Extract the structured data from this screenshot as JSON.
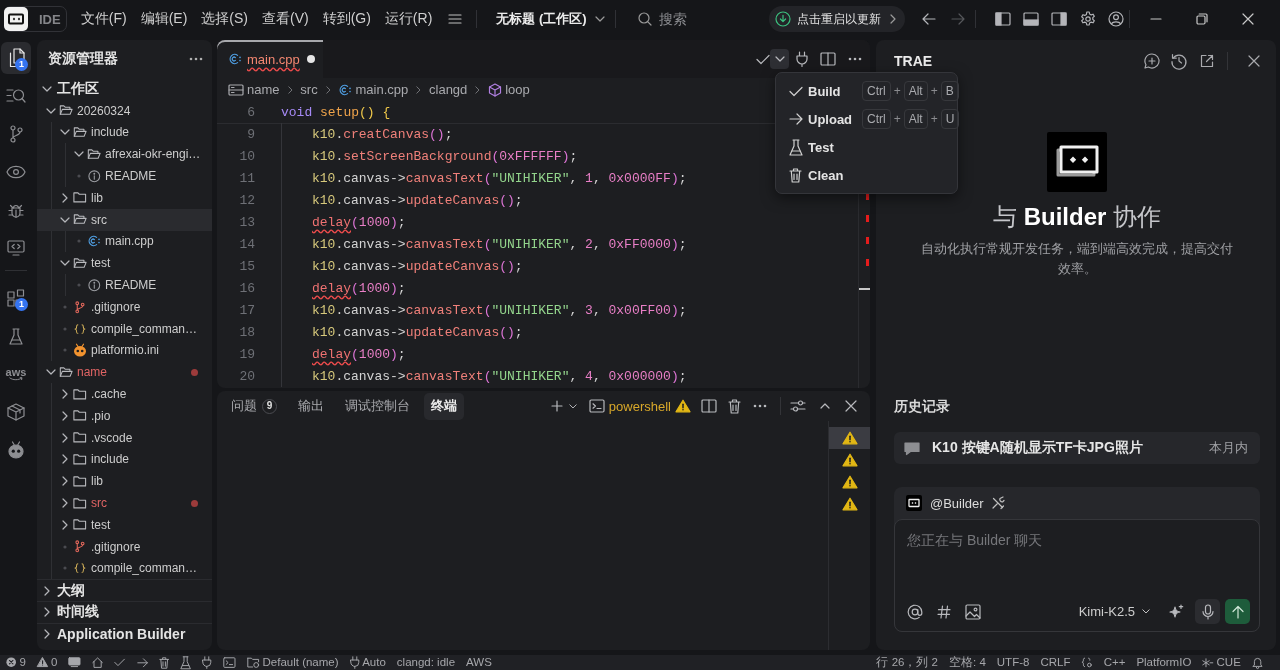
{
  "title_bar": {
    "app": "IDE",
    "menus": [
      "文件(F)",
      "编辑(E)",
      "选择(S)",
      "查看(V)",
      "转到(G)",
      "运行(R)"
    ],
    "workspace": "无标题 (工作区)",
    "search": {
      "placeholder": "搜索"
    },
    "update": "点击重启以更新",
    "navigation": [
      {
        "kind": "back",
        "disabled": false
      },
      {
        "kind": "forward",
        "disabled": true
      }
    ],
    "layout_toggles": [
      {
        "kind": "primary-sidebar",
        "on": true
      },
      {
        "kind": "panel",
        "on": true
      },
      {
        "kind": "secondary-sidebar",
        "on": true
      }
    ]
  },
  "activity_bar": {
    "groups": [
      {
        "items": [
          {
            "kind": "explorer",
            "selected": true,
            "badge": "1"
          },
          {
            "kind": "search",
            "selected": false
          },
          {
            "kind": "source-control",
            "selected": false
          },
          {
            "kind": "preview",
            "selected": false
          },
          {
            "kind": "debug",
            "selected": false
          },
          {
            "kind": "remote",
            "selected": false
          }
        ]
      },
      {
        "items": [
          {
            "kind": "extensions",
            "selected": false,
            "badge": "1"
          },
          {
            "kind": "testing",
            "selected": false
          },
          {
            "kind": "aws",
            "selected": false,
            "label": "aws"
          },
          {
            "kind": "packages",
            "selected": false
          },
          {
            "kind": "platformio",
            "selected": false
          }
        ]
      }
    ]
  },
  "explorer": {
    "title": "资源管理器",
    "tree": [
      {
        "kind": "root",
        "label": "工作区",
        "expanded": true,
        "selected": false,
        "error": false,
        "children": [
          {
            "kind": "folder",
            "label": "20260324",
            "expanded": true,
            "selected": false,
            "error": false,
            "children": [
              {
                "kind": "folder",
                "label": "include",
                "expanded": true,
                "selected": false,
                "error": false,
                "children": [
                  {
                    "kind": "folder",
                    "label": "afrexai-okr-engi…",
                    "expanded": true,
                    "selected": false,
                    "error": false
                  },
                  {
                    "kind": "readme",
                    "label": "README",
                    "selected": false,
                    "error": false
                  }
                ]
              },
              {
                "kind": "folder",
                "label": "lib",
                "expanded": false,
                "selected": false,
                "error": false
              },
              {
                "kind": "folder",
                "label": "src",
                "expanded": true,
                "selected": true,
                "error": false,
                "children": [
                  {
                    "kind": "cpp",
                    "label": "main.cpp",
                    "selected": false,
                    "error": false
                  }
                ]
              },
              {
                "kind": "folder",
                "label": "test",
                "expanded": true,
                "selected": false,
                "error": false,
                "children": [
                  {
                    "kind": "readme",
                    "label": "README",
                    "selected": false,
                    "error": false
                  }
                ]
              },
              {
                "kind": "git",
                "label": ".gitignore",
                "selected": false,
                "error": false
              },
              {
                "kind": "json",
                "label": "compile_comman…",
                "selected": false,
                "error": false
              },
              {
                "kind": "platformio",
                "label": "platformio.ini",
                "selected": false,
                "error": false
              }
            ]
          },
          {
            "kind": "folder",
            "label": "name",
            "expanded": true,
            "selected": false,
            "error": true,
            "children": [
              {
                "kind": "folder",
                "label": ".cache",
                "expanded": false,
                "selected": false,
                "error": false
              },
              {
                "kind": "folder",
                "label": ".pio",
                "expanded": false,
                "selected": false,
                "error": false
              },
              {
                "kind": "folder",
                "label": ".vscode",
                "expanded": false,
                "selected": false,
                "error": false
              },
              {
                "kind": "folder",
                "label": "include",
                "expanded": false,
                "selected": false,
                "error": false
              },
              {
                "kind": "folder",
                "label": "lib",
                "expanded": false,
                "selected": false,
                "error": false
              },
              {
                "kind": "folder",
                "label": "src",
                "expanded": false,
                "selected": false,
                "error": true
              },
              {
                "kind": "folder",
                "label": "test",
                "expanded": false,
                "selected": false,
                "error": false
              },
              {
                "kind": "git",
                "label": ".gitignore",
                "selected": false,
                "error": false
              },
              {
                "kind": "json",
                "label": "compile_comman…",
                "selected": false,
                "error": false
              }
            ]
          }
        ]
      }
    ],
    "sections": [
      {
        "label": "大纲",
        "expanded": false
      },
      {
        "label": "时间线",
        "expanded": false
      },
      {
        "label": "Application Builder",
        "expanded": false
      }
    ]
  },
  "editor": {
    "tabs": [
      {
        "kind": "cpp",
        "label": "main.cpp",
        "selected": true,
        "modified": true,
        "error": true
      }
    ],
    "run_menu": {
      "open": true,
      "items": [
        {
          "kind": "build",
          "label": "Build",
          "shortcut": [
            "Ctrl",
            "+",
            "Alt",
            "+",
            "B"
          ]
        },
        {
          "kind": "upload",
          "label": "Upload",
          "shortcut": [
            "Ctrl",
            "+",
            "Alt",
            "+",
            "U"
          ]
        },
        {
          "kind": "test",
          "label": "Test"
        },
        {
          "kind": "clean",
          "label": "Clean"
        }
      ]
    },
    "breadcrumb": [
      {
        "kind": "root",
        "label": "name"
      },
      {
        "kind": "folder",
        "label": "src"
      },
      {
        "kind": "cpp",
        "label": "main.cpp"
      },
      {
        "kind": "text",
        "label": "clangd"
      },
      {
        "kind": "symbol",
        "label": "loop"
      }
    ],
    "sticky_lines": [
      {
        "number": "6",
        "indented": false,
        "tokens": [
          {
            "kind": "kw",
            "text": "void"
          },
          {
            "kind": "fndef",
            "text": " setup"
          },
          {
            "kind": "bracket",
            "text": "() {"
          }
        ]
      }
    ],
    "lines": [
      {
        "number": "9",
        "indented": true,
        "tokens": [
          {
            "kind": "var",
            "text": "k10"
          },
          {
            "kind": "plain",
            "text": "."
          },
          {
            "kind": "fn",
            "text": "creatCanvas"
          },
          {
            "kind": "paren",
            "text": "()"
          },
          {
            "kind": "plain",
            "text": ";"
          }
        ]
      },
      {
        "number": "10",
        "indented": true,
        "tokens": [
          {
            "kind": "var",
            "text": "k10"
          },
          {
            "kind": "plain",
            "text": "."
          },
          {
            "kind": "fn",
            "text": "setScreenBackground"
          },
          {
            "kind": "paren",
            "text": "("
          },
          {
            "kind": "num",
            "text": "0xFFFFFF"
          },
          {
            "kind": "paren",
            "text": ")"
          },
          {
            "kind": "plain",
            "text": ";"
          }
        ]
      },
      {
        "number": "11",
        "indented": true,
        "tokens": [
          {
            "kind": "var",
            "text": "k10"
          },
          {
            "kind": "plain",
            "text": ".canvas->"
          },
          {
            "kind": "fn",
            "text": "canvasText"
          },
          {
            "kind": "paren",
            "text": "("
          },
          {
            "kind": "str",
            "text": "\"UNIHIKER\""
          },
          {
            "kind": "plain",
            "text": ", "
          },
          {
            "kind": "num",
            "text": "1"
          },
          {
            "kind": "plain",
            "text": ", "
          },
          {
            "kind": "num",
            "text": "0x0000FF"
          },
          {
            "kind": "paren",
            "text": ")"
          },
          {
            "kind": "plain",
            "text": ";"
          }
        ]
      },
      {
        "number": "12",
        "indented": true,
        "tokens": [
          {
            "kind": "var",
            "text": "k10"
          },
          {
            "kind": "plain",
            "text": ".canvas->"
          },
          {
            "kind": "fn",
            "text": "updateCanvas"
          },
          {
            "kind": "paren",
            "text": "()"
          },
          {
            "kind": "plain",
            "text": ";"
          }
        ]
      },
      {
        "number": "13",
        "indented": true,
        "tokens": [
          {
            "kind": "unresolved",
            "text": "delay"
          },
          {
            "kind": "paren",
            "text": "("
          },
          {
            "kind": "num",
            "text": "1000"
          },
          {
            "kind": "paren",
            "text": ")"
          },
          {
            "kind": "plain",
            "text": ";"
          }
        ]
      },
      {
        "number": "14",
        "indented": true,
        "tokens": [
          {
            "kind": "var",
            "text": "k10"
          },
          {
            "kind": "plain",
            "text": ".canvas->"
          },
          {
            "kind": "fn",
            "text": "canvasText"
          },
          {
            "kind": "paren",
            "text": "("
          },
          {
            "kind": "str",
            "text": "\"UNIHIKER\""
          },
          {
            "kind": "plain",
            "text": ", "
          },
          {
            "kind": "num",
            "text": "2"
          },
          {
            "kind": "plain",
            "text": ", "
          },
          {
            "kind": "num",
            "text": "0xFF0000"
          },
          {
            "kind": "paren",
            "text": ")"
          },
          {
            "kind": "plain",
            "text": ";"
          }
        ]
      },
      {
        "number": "15",
        "indented": true,
        "tokens": [
          {
            "kind": "var",
            "text": "k10"
          },
          {
            "kind": "plain",
            "text": ".canvas->"
          },
          {
            "kind": "fn",
            "text": "updateCanvas"
          },
          {
            "kind": "paren",
            "text": "()"
          },
          {
            "kind": "plain",
            "text": ";"
          }
        ]
      },
      {
        "number": "16",
        "indented": true,
        "tokens": [
          {
            "kind": "unresolved",
            "text": "delay"
          },
          {
            "kind": "paren",
            "text": "("
          },
          {
            "kind": "num",
            "text": "1000"
          },
          {
            "kind": "paren",
            "text": ")"
          },
          {
            "kind": "plain",
            "text": ";"
          }
        ]
      },
      {
        "number": "17",
        "indented": true,
        "tokens": [
          {
            "kind": "var",
            "text": "k10"
          },
          {
            "kind": "plain",
            "text": ".canvas->"
          },
          {
            "kind": "fn",
            "text": "canvasText"
          },
          {
            "kind": "paren",
            "text": "("
          },
          {
            "kind": "str",
            "text": "\"UNIHIKER\""
          },
          {
            "kind": "plain",
            "text": ", "
          },
          {
            "kind": "num",
            "text": "3"
          },
          {
            "kind": "plain",
            "text": ", "
          },
          {
            "kind": "num",
            "text": "0x00FF00"
          },
          {
            "kind": "paren",
            "text": ")"
          },
          {
            "kind": "plain",
            "text": ";"
          }
        ]
      },
      {
        "number": "18",
        "indented": true,
        "tokens": [
          {
            "kind": "var",
            "text": "k10"
          },
          {
            "kind": "plain",
            "text": ".canvas->"
          },
          {
            "kind": "fn",
            "text": "updateCanvas"
          },
          {
            "kind": "paren",
            "text": "()"
          },
          {
            "kind": "plain",
            "text": ";"
          }
        ]
      },
      {
        "number": "19",
        "indented": true,
        "tokens": [
          {
            "kind": "unresolved",
            "text": "delay"
          },
          {
            "kind": "paren",
            "text": "("
          },
          {
            "kind": "num",
            "text": "1000"
          },
          {
            "kind": "paren",
            "text": ")"
          },
          {
            "kind": "plain",
            "text": ";"
          }
        ]
      },
      {
        "number": "20",
        "indented": true,
        "tokens": [
          {
            "kind": "var",
            "text": "k10"
          },
          {
            "kind": "plain",
            "text": ".canvas->"
          },
          {
            "kind": "fn",
            "text": "canvasText"
          },
          {
            "kind": "paren",
            "text": "("
          },
          {
            "kind": "str",
            "text": "\"UNIHIKER\""
          },
          {
            "kind": "plain",
            "text": ", "
          },
          {
            "kind": "num",
            "text": "4"
          },
          {
            "kind": "plain",
            "text": ", "
          },
          {
            "kind": "num",
            "text": "0x000000"
          },
          {
            "kind": "paren",
            "text": ")"
          },
          {
            "kind": "plain",
            "text": ";"
          }
        ]
      }
    ],
    "overview_ruler": [
      {
        "kind": "error"
      },
      {
        "kind": "error"
      },
      {
        "kind": "error"
      },
      {
        "kind": "error"
      },
      {
        "kind": "cursor"
      }
    ]
  },
  "panel": {
    "tabs": [
      {
        "label": "问题",
        "badge": "9",
        "selected": false
      },
      {
        "label": "输出",
        "selected": false
      },
      {
        "label": "调试控制台",
        "selected": false
      },
      {
        "label": "终端",
        "selected": true
      }
    ],
    "terminal": {
      "name": "powershell",
      "warning": true
    },
    "terminal_list": [
      {
        "selected": true,
        "warning": true
      },
      {
        "selected": false,
        "warning": true
      },
      {
        "selected": false,
        "warning": true
      },
      {
        "selected": false,
        "warning": true
      }
    ]
  },
  "assistant": {
    "title": "TRAE",
    "heading": "与 **Builder** 协作",
    "description": "自动化执行常规开发任务，端到端高效完成，提高交付效率。",
    "history_title": "历史记录",
    "history": [
      {
        "title": "K10 按键A随机显示TF卡JPG照片",
        "time": "本月内"
      }
    ],
    "chat": {
      "agent": "@Builder",
      "placeholder": "您正在与 Builder 聊天",
      "model": "Kimi-K2.5"
    }
  },
  "status_bar": {
    "left": [
      {
        "kind": "errors",
        "text": "9"
      },
      {
        "kind": "warnings",
        "text": "0"
      },
      {
        "kind": "board"
      },
      {
        "kind": "home"
      },
      {
        "kind": "check"
      },
      {
        "kind": "arrow"
      },
      {
        "kind": "trash"
      },
      {
        "kind": "flask"
      },
      {
        "kind": "plug"
      },
      {
        "kind": "terminal"
      },
      {
        "kind": "env",
        "text": "Default (name)"
      },
      {
        "kind": "auto",
        "text": "Auto"
      },
      {
        "kind": "text",
        "text": "clangd: idle"
      },
      {
        "kind": "text",
        "text": "AWS"
      }
    ],
    "right": [
      {
        "kind": "text",
        "text": "行 26，列 2"
      },
      {
        "kind": "text",
        "text": "空格: 4"
      },
      {
        "kind": "text",
        "text": "UTF-8"
      },
      {
        "kind": "text",
        "text": "CRLF"
      },
      {
        "kind": "braces"
      },
      {
        "kind": "text",
        "text": "C++"
      },
      {
        "kind": "text",
        "text": "PlatformIO"
      },
      {
        "kind": "cue",
        "text": "CUE"
      },
      {
        "kind": "bell"
      }
    ]
  }
}
